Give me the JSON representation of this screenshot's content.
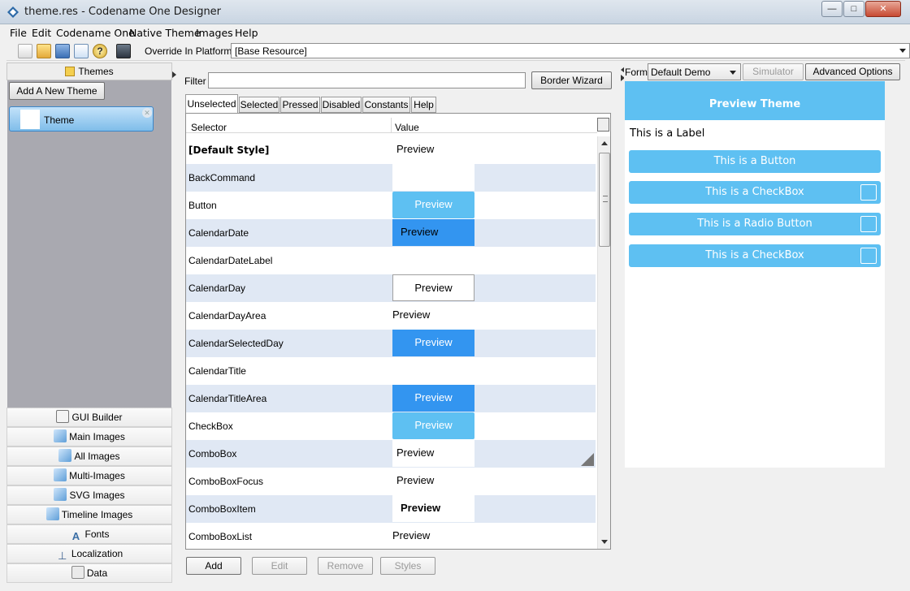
{
  "window": {
    "title": "theme.res - Codename One Designer",
    "min": "—",
    "max": "□",
    "close": "✕"
  },
  "menu": [
    "File",
    "Edit",
    "Codename One",
    "Native Theme",
    "Images",
    "Help"
  ],
  "toolbar": {
    "override_label": "Override In Platform:",
    "platform_value": "[Base Resource]",
    "icons": [
      "new-file-icon",
      "open-folder-icon",
      "save-icon",
      "edit-icon",
      "help-icon",
      "export-icon"
    ]
  },
  "sidebar": {
    "themes_tab": "Themes",
    "add_theme": "Add A New Theme",
    "theme_item": "Theme",
    "nav": [
      {
        "label": "GUI Builder",
        "icon": "gui-builder-icon"
      },
      {
        "label": "Main Images",
        "icon": "images-icon"
      },
      {
        "label": "All Images",
        "icon": "images-icon"
      },
      {
        "label": "Multi-Images",
        "icon": "images-icon"
      },
      {
        "label": "SVG Images",
        "icon": "images-icon"
      },
      {
        "label": "Timeline Images",
        "icon": "images-icon"
      },
      {
        "label": "Fonts",
        "icon": "fonts-icon"
      },
      {
        "label": "Localization",
        "icon": "pin-icon"
      },
      {
        "label": "Data",
        "icon": "data-icon"
      }
    ]
  },
  "center": {
    "filter_label": "Filter",
    "filter_value": "",
    "border_wizard": "Border Wizard",
    "tabs": [
      "Unselected",
      "Selected",
      "Pressed",
      "Disabled",
      "Constants",
      "Help"
    ],
    "columns": [
      "Selector",
      "Value"
    ],
    "rows": [
      {
        "selector": "[Default Style]",
        "preview": "Preview",
        "style": "plain",
        "bold_sel": true
      },
      {
        "selector": "BackCommand",
        "preview": "",
        "style": "white"
      },
      {
        "selector": "Button",
        "preview": "Preview",
        "style": "lightblue"
      },
      {
        "selector": "CalendarDate",
        "preview": "Preview",
        "style": "blue-left"
      },
      {
        "selector": "CalendarDateLabel",
        "preview": "",
        "style": "none"
      },
      {
        "selector": "CalendarDay",
        "preview": "Preview",
        "style": "whitebox"
      },
      {
        "selector": "CalendarDayArea",
        "preview": "Preview",
        "style": "plain-left"
      },
      {
        "selector": "CalendarSelectedDay",
        "preview": "Preview",
        "style": "blue"
      },
      {
        "selector": "CalendarTitle",
        "preview": "",
        "style": "none"
      },
      {
        "selector": "CalendarTitleArea",
        "preview": "Preview",
        "style": "blue"
      },
      {
        "selector": "CheckBox",
        "preview": "Preview",
        "style": "lightblue"
      },
      {
        "selector": "ComboBox",
        "preview": "Preview",
        "style": "combo"
      },
      {
        "selector": "ComboBoxFocus",
        "preview": "Preview",
        "style": "plain"
      },
      {
        "selector": "ComboBoxItem",
        "preview": "Preview",
        "style": "bold"
      },
      {
        "selector": "ComboBoxList",
        "preview": "Preview",
        "style": "plain-left"
      }
    ],
    "buttons": {
      "add": "Add",
      "edit": "Edit",
      "remove": "Remove",
      "styles": "Styles"
    }
  },
  "right": {
    "form_label": "Form:",
    "form_value": "Default Demo",
    "simulator": "Simulator",
    "advanced": "Advanced Options",
    "preview": {
      "title": "Preview Theme",
      "label": "This is a Label",
      "items": [
        {
          "text": "This is a Button",
          "box": false
        },
        {
          "text": "This is a CheckBox",
          "box": true
        },
        {
          "text": "This is a Radio Button",
          "box": true
        },
        {
          "text": "This is a CheckBox",
          "box": true
        }
      ]
    }
  },
  "colors": {
    "accent_light": "#5ec0f2",
    "accent_blue": "#3395f0",
    "row_alt": "#e0e8f4"
  }
}
